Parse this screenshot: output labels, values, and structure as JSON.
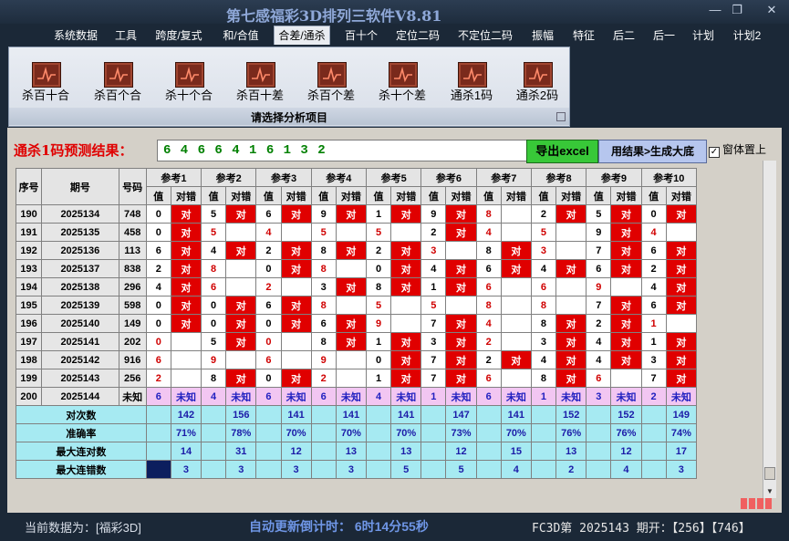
{
  "window": {
    "title": "第七感福彩3D排列三软件V8.81",
    "min": "—",
    "max": "❐",
    "close": "✕"
  },
  "menu": [
    "系统数据",
    "工具",
    "跨度/复式",
    "和/合值",
    "合差/通杀",
    "百十个",
    "定位二码",
    "不定位二码",
    "振幅",
    "特征",
    "后二",
    "后一",
    "计划",
    "计划2"
  ],
  "menu_active": "合差/通杀",
  "ribbon": {
    "buttons": [
      "杀百十合",
      "杀百个合",
      "杀十个合",
      "杀百十差",
      "杀百个差",
      "杀十个差",
      "通杀1码",
      "通杀2码"
    ],
    "caption": "请选择分析项目"
  },
  "prediction": {
    "label": "通杀1码预测结果：",
    "value": "6 4 6 6 4 1 6 1 3 2",
    "export_btn": "导出excel",
    "generate_btn": "用结果>生成大底",
    "topmost_label": "窗体置上",
    "topmost_checked": "✓"
  },
  "table": {
    "col_seq": "序号",
    "col_period": "期号",
    "col_number": "号码",
    "groups": [
      "参考1",
      "参考2",
      "参考3",
      "参考4",
      "参考5",
      "参考6",
      "参考7",
      "参考8",
      "参考9",
      "参考10"
    ],
    "sub_value": "值",
    "sub_result": "对错",
    "hit_text": "对",
    "rows": [
      {
        "seq": "190",
        "period": "2025134",
        "number": "748",
        "cells": [
          [
            "0",
            "对"
          ],
          [
            "5",
            "对"
          ],
          [
            "6",
            "对"
          ],
          [
            "9",
            "对"
          ],
          [
            "1",
            "对"
          ],
          [
            "9",
            "对"
          ],
          [
            "8",
            ""
          ],
          [
            "2",
            "对"
          ],
          [
            "5",
            "对"
          ],
          [
            "0",
            "对"
          ]
        ]
      },
      {
        "seq": "191",
        "period": "2025135",
        "number": "458",
        "cells": [
          [
            "0",
            "对"
          ],
          [
            "5",
            ""
          ],
          [
            "4",
            ""
          ],
          [
            "5",
            ""
          ],
          [
            "5",
            ""
          ],
          [
            "2",
            "对"
          ],
          [
            "4",
            ""
          ],
          [
            "5",
            ""
          ],
          [
            "9",
            "对"
          ],
          [
            "4",
            ""
          ]
        ]
      },
      {
        "seq": "192",
        "period": "2025136",
        "number": "113",
        "cells": [
          [
            "6",
            "对"
          ],
          [
            "4",
            "对"
          ],
          [
            "2",
            "对"
          ],
          [
            "8",
            "对"
          ],
          [
            "2",
            "对"
          ],
          [
            "3",
            ""
          ],
          [
            "8",
            "对"
          ],
          [
            "3",
            ""
          ],
          [
            "7",
            "对"
          ],
          [
            "6",
            "对"
          ]
        ]
      },
      {
        "seq": "193",
        "period": "2025137",
        "number": "838",
        "cells": [
          [
            "2",
            "对"
          ],
          [
            "8",
            ""
          ],
          [
            "0",
            "对"
          ],
          [
            "8",
            ""
          ],
          [
            "0",
            "对"
          ],
          [
            "4",
            "对"
          ],
          [
            "6",
            "对"
          ],
          [
            "4",
            "对"
          ],
          [
            "6",
            "对"
          ],
          [
            "2",
            "对"
          ]
        ]
      },
      {
        "seq": "194",
        "period": "2025138",
        "number": "296",
        "cells": [
          [
            "4",
            "对"
          ],
          [
            "6",
            ""
          ],
          [
            "2",
            ""
          ],
          [
            "3",
            "对"
          ],
          [
            "8",
            "对"
          ],
          [
            "1",
            "对"
          ],
          [
            "6",
            ""
          ],
          [
            "6",
            ""
          ],
          [
            "9",
            ""
          ],
          [
            "4",
            "对"
          ]
        ]
      },
      {
        "seq": "195",
        "period": "2025139",
        "number": "598",
        "cells": [
          [
            "0",
            "对"
          ],
          [
            "0",
            "对"
          ],
          [
            "6",
            "对"
          ],
          [
            "8",
            ""
          ],
          [
            "5",
            ""
          ],
          [
            "5",
            ""
          ],
          [
            "8",
            ""
          ],
          [
            "8",
            ""
          ],
          [
            "7",
            "对"
          ],
          [
            "6",
            "对"
          ]
        ]
      },
      {
        "seq": "196",
        "period": "2025140",
        "number": "149",
        "cells": [
          [
            "0",
            "对"
          ],
          [
            "0",
            "对"
          ],
          [
            "0",
            "对"
          ],
          [
            "6",
            "对"
          ],
          [
            "9",
            ""
          ],
          [
            "7",
            "对"
          ],
          [
            "4",
            ""
          ],
          [
            "8",
            "对"
          ],
          [
            "2",
            "对"
          ],
          [
            "1",
            ""
          ]
        ]
      },
      {
        "seq": "197",
        "period": "2025141",
        "number": "202",
        "cells": [
          [
            "0",
            ""
          ],
          [
            "5",
            "对"
          ],
          [
            "0",
            ""
          ],
          [
            "8",
            "对"
          ],
          [
            "1",
            "对"
          ],
          [
            "3",
            "对"
          ],
          [
            "2",
            ""
          ],
          [
            "3",
            "对"
          ],
          [
            "4",
            "对"
          ],
          [
            "1",
            "对"
          ]
        ]
      },
      {
        "seq": "198",
        "period": "2025142",
        "number": "916",
        "cells": [
          [
            "6",
            ""
          ],
          [
            "9",
            ""
          ],
          [
            "6",
            ""
          ],
          [
            "9",
            ""
          ],
          [
            "0",
            "对"
          ],
          [
            "7",
            "对"
          ],
          [
            "2",
            "对"
          ],
          [
            "4",
            "对"
          ],
          [
            "4",
            "对"
          ],
          [
            "3",
            "对"
          ]
        ]
      },
      {
        "seq": "199",
        "period": "2025143",
        "number": "256",
        "cells": [
          [
            "2",
            ""
          ],
          [
            "8",
            "对"
          ],
          [
            "0",
            "对"
          ],
          [
            "2",
            ""
          ],
          [
            "1",
            "对"
          ],
          [
            "7",
            "对"
          ],
          [
            "6",
            ""
          ],
          [
            "8",
            "对"
          ],
          [
            "6",
            ""
          ],
          [
            "7",
            "对"
          ]
        ]
      }
    ],
    "pending": {
      "seq": "200",
      "period": "2025144",
      "number": "未知",
      "values": [
        "6",
        "4",
        "6",
        "6",
        "4",
        "1",
        "6",
        "1",
        "3",
        "2"
      ],
      "result": "未知"
    },
    "stats": [
      {
        "label": "对次数",
        "values": [
          "142",
          "156",
          "141",
          "141",
          "141",
          "147",
          "141",
          "152",
          "152",
          "149"
        ]
      },
      {
        "label": "准确率",
        "values": [
          "71%",
          "78%",
          "70%",
          "70%",
          "70%",
          "73%",
          "70%",
          "76%",
          "76%",
          "74%"
        ]
      },
      {
        "label": "最大连对数",
        "values": [
          "14",
          "31",
          "12",
          "13",
          "13",
          "12",
          "15",
          "13",
          "12",
          "17"
        ]
      },
      {
        "label": "最大连错数",
        "values": [
          "3",
          "3",
          "3",
          "3",
          "5",
          "5",
          "4",
          "2",
          "4",
          "3"
        ]
      }
    ]
  },
  "status": {
    "current": "当前数据为：[福彩3D]",
    "countdown": "自动更新倒计时：  6时14分55秒",
    "draw": "FC3D第 2025143 期开：【256】【746】"
  },
  "colors": {
    "hit": "#e00000",
    "pending": "#f2c6f2",
    "stat": "#a6eaf2",
    "prediction": "#008000",
    "export": "#38c838"
  }
}
